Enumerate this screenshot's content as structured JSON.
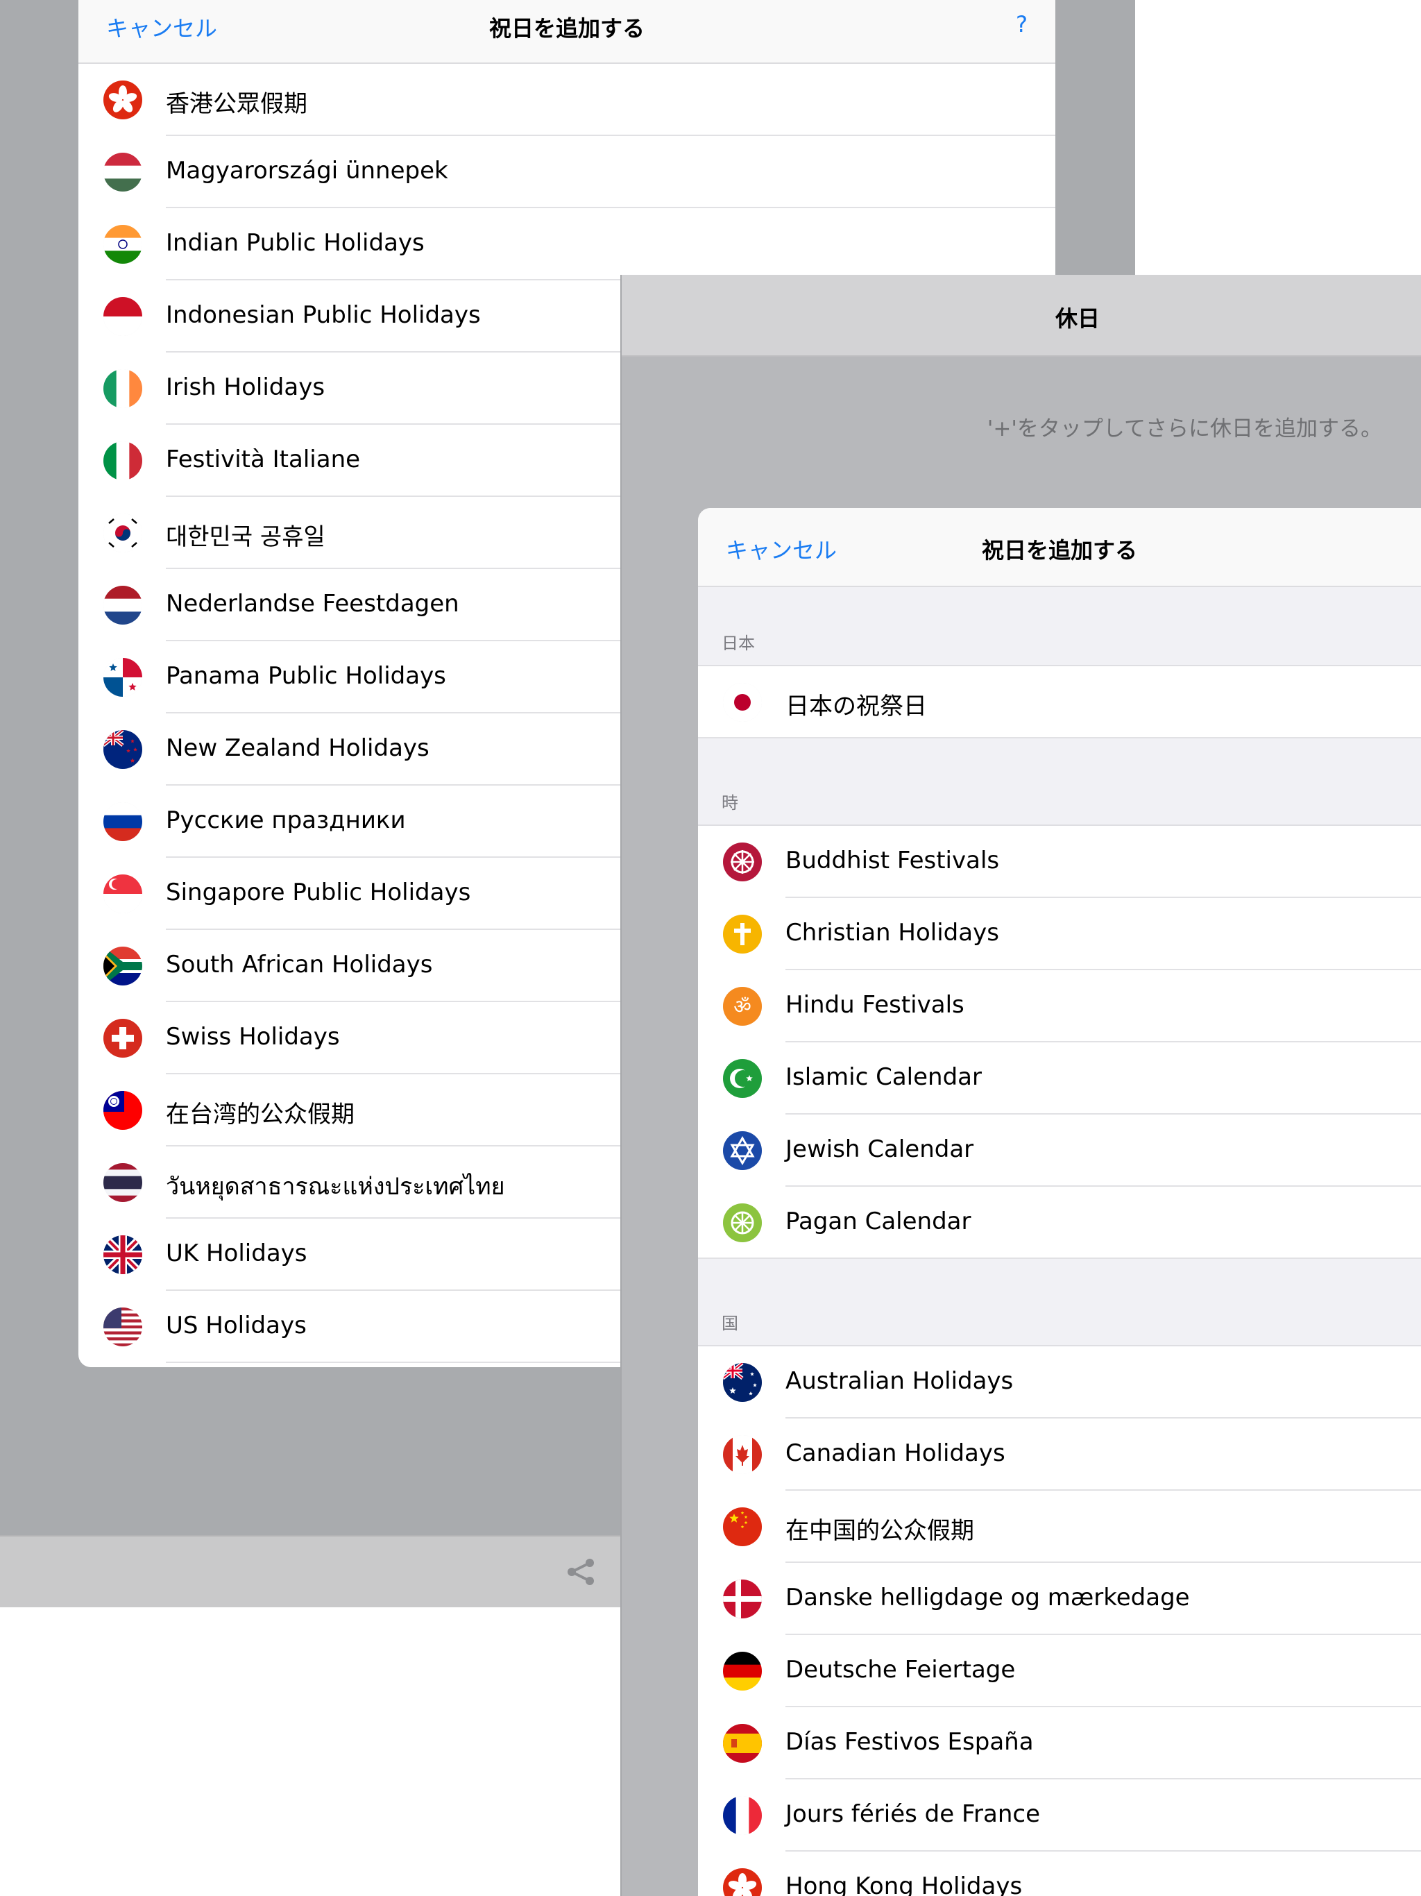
{
  "sheet1": {
    "cancel": "キャンセル",
    "title": "祝日を追加する",
    "help": "?",
    "items": [
      {
        "label": "香港公眾假期",
        "flag": "hk"
      },
      {
        "label": "Magyarországi ünnepek",
        "flag": "hu"
      },
      {
        "label": "Indian Public Holidays",
        "flag": "in"
      },
      {
        "label": "Indonesian Public Holidays",
        "flag": "id"
      },
      {
        "label": "Irish Holidays",
        "flag": "ie"
      },
      {
        "label": "Festività Italiane",
        "flag": "it"
      },
      {
        "label": "대한민국 공휴일",
        "flag": "kr"
      },
      {
        "label": "Nederlandse Feestdagen",
        "flag": "nl"
      },
      {
        "label": "Panama Public Holidays",
        "flag": "pa"
      },
      {
        "label": "New Zealand Holidays",
        "flag": "nz"
      },
      {
        "label": "Русские праздники",
        "flag": "ru"
      },
      {
        "label": "Singapore Public Holidays",
        "flag": "sg"
      },
      {
        "label": "South African Holidays",
        "flag": "za"
      },
      {
        "label": "Swiss Holidays",
        "flag": "ch"
      },
      {
        "label": "在台湾的公众假期",
        "flag": "tw"
      },
      {
        "label": "วันหยุดสาธารณะแห่งประเทศไทย",
        "flag": "th"
      },
      {
        "label": "UK Holidays",
        "flag": "gb"
      },
      {
        "label": "US Holidays",
        "flag": "us"
      }
    ]
  },
  "panel": {
    "title": "休日",
    "hint": "'+'をタップしてさらに休日を追加する。"
  },
  "sheet2": {
    "cancel": "キャンセル",
    "title": "祝日を追加する",
    "sections": [
      {
        "label": "日本",
        "items": [
          {
            "label": "日本の祝祭日",
            "flag": "jp"
          }
        ]
      },
      {
        "label": "時",
        "items": [
          {
            "label": "Buddhist Festivals",
            "flag": "buddhist"
          },
          {
            "label": "Christian Holidays",
            "flag": "christian"
          },
          {
            "label": "Hindu Festivals",
            "flag": "hindu"
          },
          {
            "label": "Islamic Calendar",
            "flag": "islamic"
          },
          {
            "label": "Jewish Calendar",
            "flag": "jewish"
          },
          {
            "label": "Pagan Calendar",
            "flag": "pagan"
          }
        ]
      },
      {
        "label": "国",
        "items": [
          {
            "label": "Australian Holidays",
            "flag": "au"
          },
          {
            "label": "Canadian Holidays",
            "flag": "ca"
          },
          {
            "label": "在中国的公众假期",
            "flag": "cn"
          },
          {
            "label": "Danske helligdage og mærkedage",
            "flag": "dk"
          },
          {
            "label": "Deutsche Feiertage",
            "flag": "de"
          },
          {
            "label": "Días Festivos España",
            "flag": "es"
          },
          {
            "label": "Jours fériés de France",
            "flag": "fr"
          },
          {
            "label": "Hong Kong Holidays",
            "flag": "hk"
          }
        ]
      }
    ]
  },
  "icons": {
    "toolbar_share": "share-icon"
  }
}
